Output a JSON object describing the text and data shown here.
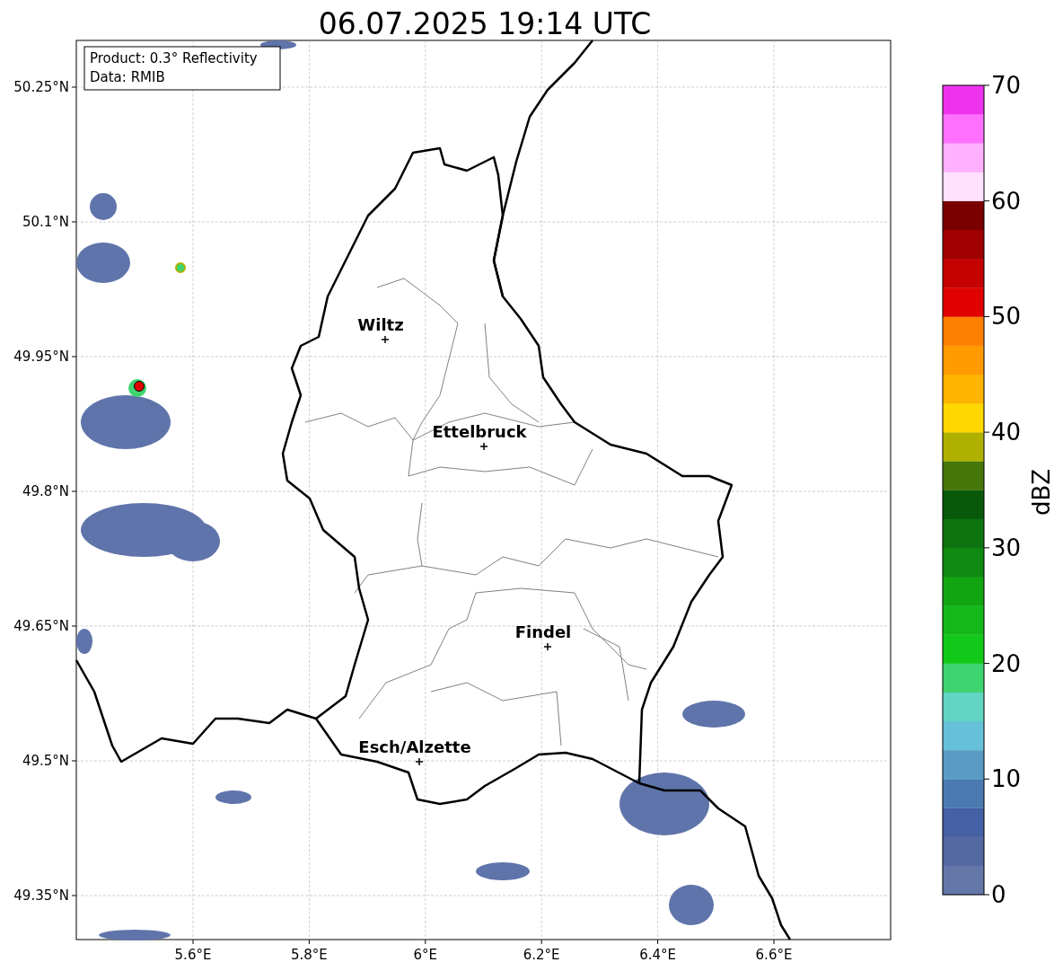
{
  "title": "06.07.2025 19:14 UTC",
  "info_box": {
    "lines": [
      "Product: 0.3° Reflectivity",
      "Data: RMIB"
    ]
  },
  "map": {
    "x_ticks": [
      "5.6°E",
      "5.8°E",
      "6°E",
      "6.2°E",
      "6.4°E",
      "6.6°E"
    ],
    "y_ticks": [
      "50.25°N",
      "50.1°N",
      "49.95°N",
      "49.8°N",
      "49.65°N",
      "49.5°N",
      "49.35°N"
    ],
    "cities": [
      {
        "name": "Wiltz"
      },
      {
        "name": "Ettelbruck"
      },
      {
        "name": "Findel"
      },
      {
        "name": "Esch/Alzette"
      }
    ]
  },
  "colorbar": {
    "label": "dBZ",
    "ticks": [
      "70",
      "60",
      "50",
      "40",
      "30",
      "20",
      "10",
      "0"
    ],
    "segments": [
      {
        "color": "#6577a8"
      },
      {
        "color": "#5468a2"
      },
      {
        "color": "#4560a4"
      },
      {
        "color": "#4b7ab0"
      },
      {
        "color": "#5a9bc5"
      },
      {
        "color": "#66c0da"
      },
      {
        "color": "#62d5c4"
      },
      {
        "color": "#3ed470"
      },
      {
        "color": "#12c91a"
      },
      {
        "color": "#13b919"
      },
      {
        "color": "#12a512"
      },
      {
        "color": "#108a10"
      },
      {
        "color": "#0e7410"
      },
      {
        "color": "#085a0a"
      },
      {
        "color": "#46760a"
      },
      {
        "color": "#b0b000"
      },
      {
        "color": "#ffd800"
      },
      {
        "color": "#ffb400"
      },
      {
        "color": "#ff9a00"
      },
      {
        "color": "#ff7f00"
      },
      {
        "color": "#e00000"
      },
      {
        "color": "#c40000"
      },
      {
        "color": "#a00000"
      },
      {
        "color": "#7a0000"
      },
      {
        "color": "#ffe0ff"
      },
      {
        "color": "#ffb0ff"
      },
      {
        "color": "#ff70ff"
      },
      {
        "color": "#ee33ee"
      }
    ]
  }
}
